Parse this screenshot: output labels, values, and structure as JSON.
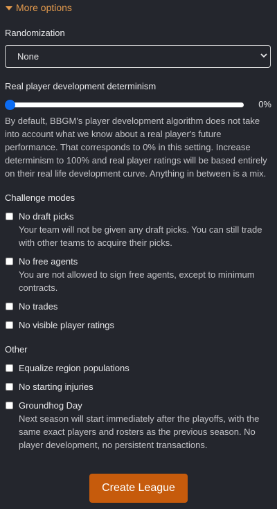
{
  "more_options": {
    "label": "More options"
  },
  "randomization": {
    "label": "Randomization",
    "selected": "None"
  },
  "determinism": {
    "label": "Real player development determinism",
    "value": 0,
    "value_text": "0%",
    "description_lines": [
      "By default, BBGM's player development algorithm does not take",
      "into account what we know about a real player's future",
      "performance. That corresponds to 0% in this setting. Increase",
      "determinism to 100% and real player ratings will be based entirely",
      "on their real life development curve. Anything in between is a mix."
    ]
  },
  "challenge_modes": {
    "heading": "Challenge modes",
    "items": [
      {
        "label": "No draft picks",
        "checked": false,
        "description_lines": [
          "Your team will not be given any draft picks. You can still trade",
          "with other teams to acquire their picks."
        ]
      },
      {
        "label": "No free agents",
        "checked": false,
        "description_lines": [
          "You are not allowed to sign free agents, except to minimum",
          "contracts."
        ]
      },
      {
        "label": "No trades",
        "checked": false
      },
      {
        "label": "No visible player ratings",
        "checked": false
      }
    ]
  },
  "other": {
    "heading": "Other",
    "items": [
      {
        "label": "Equalize region populations",
        "checked": false
      },
      {
        "label": "No starting injuries",
        "checked": false
      },
      {
        "label": "Groundhog Day",
        "checked": false,
        "description_lines": [
          "Next season will start immediately after the playoffs, with the",
          "same exact players and rosters as the previous season. No",
          "player development, no persistent transactions."
        ]
      }
    ]
  },
  "create_button": {
    "label": "Create League"
  },
  "colors": {
    "accent": "#e39a4d",
    "button": "#c65b0c",
    "slider_thumb": "#0c6cf2",
    "background": "#24262d"
  },
  "icons": {
    "more_options": "caret-down-icon",
    "select": "chevron-down-icon"
  }
}
